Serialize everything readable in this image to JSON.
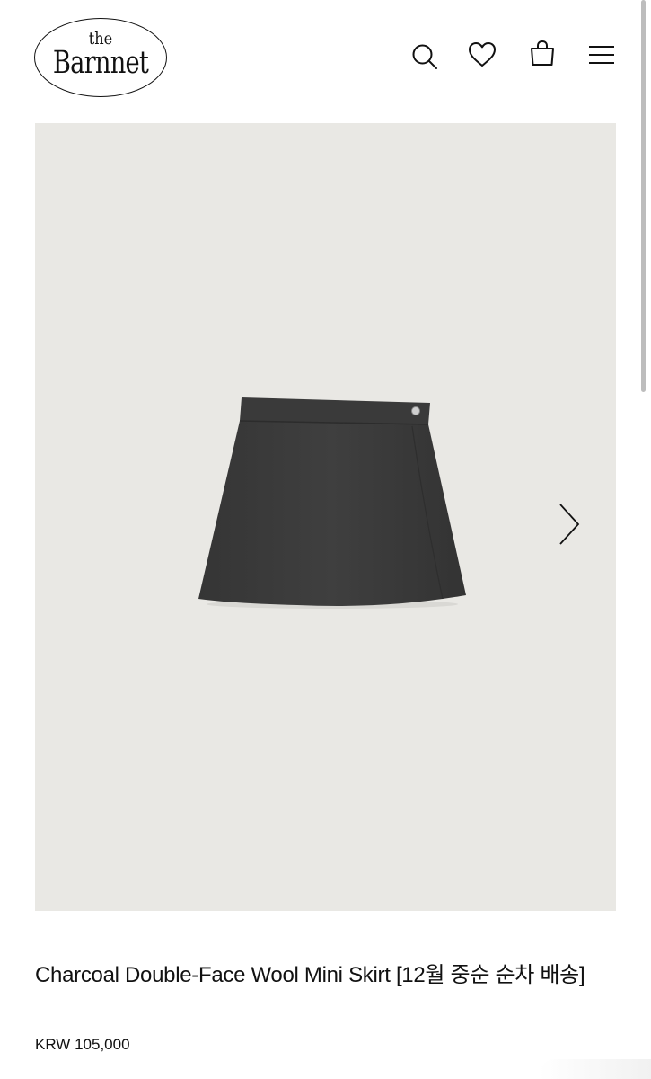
{
  "header": {
    "logo_small": "the",
    "logo_name": "Barnnet",
    "icons": [
      "search-icon",
      "heart-icon",
      "bag-icon",
      "menu-icon"
    ]
  },
  "gallery": {
    "background": "#e9e8e4",
    "product_color": "#3b3b3b",
    "next_icon": "chevron-right-icon"
  },
  "product": {
    "title": "Charcoal Double-Face Wool Mini Skirt [12월 중순 순차 배송]",
    "price": "KRW 105,000"
  }
}
